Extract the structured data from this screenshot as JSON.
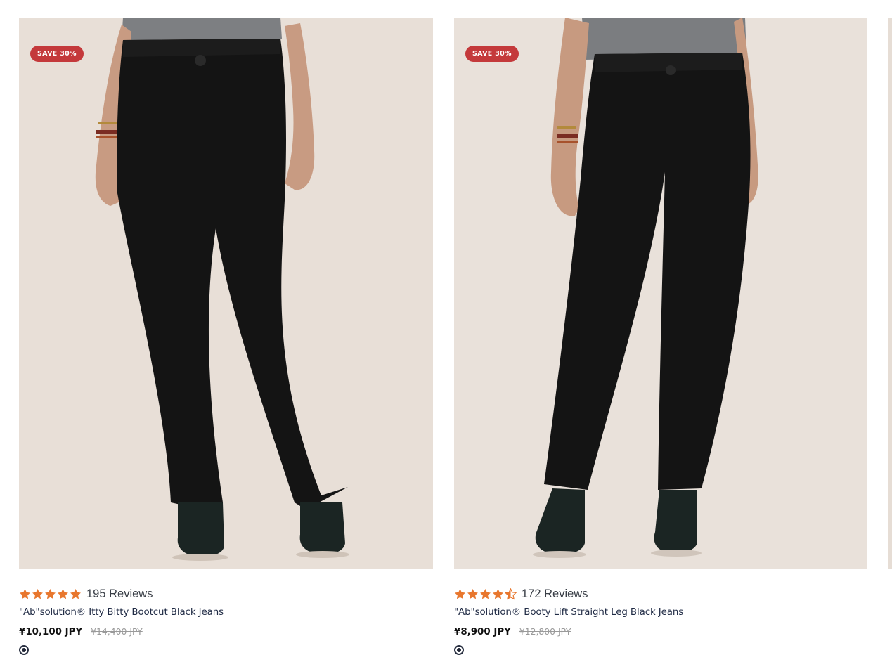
{
  "products": [
    {
      "badge": "SAVE 30%",
      "rating": 5,
      "reviews": "195 Reviews",
      "title": "\"Ab\"solution® Itty Bitty Bootcut Black Jeans",
      "price": "¥10,100 JPY",
      "compare_price": "¥14,400 JPY",
      "swatch_color": "#1f2535",
      "image_icon": "bootcut-jeans-photo"
    },
    {
      "badge": "SAVE 30%",
      "rating": 4.5,
      "reviews": "172 Reviews",
      "title": "\"Ab\"solution® Booty Lift Straight Leg Black Jeans",
      "price": "¥8,900 JPY",
      "compare_price": "¥12,800 JPY",
      "swatch_color": "#1f2535",
      "image_icon": "straight-leg-jeans-photo"
    }
  ],
  "colors": {
    "badge": "#c4393b",
    "star": "#e8772e",
    "image_bg": "#e8dfd7"
  }
}
